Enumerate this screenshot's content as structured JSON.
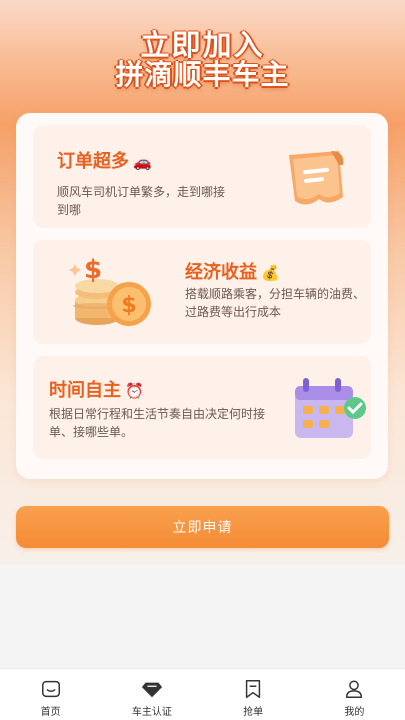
{
  "hero": {
    "title_line1": "立即加入",
    "title_line2": "拼滴顺丰车主"
  },
  "cards": [
    {
      "title": "订单超多",
      "emoji": "🚗",
      "desc": "顺风车司机订单繁多，走到哪接到哪",
      "icon": "receipt-icon"
    },
    {
      "title": "经济收益",
      "emoji": "💰",
      "desc": "搭载顺路乘客，分担车辆的油费、过路费等出行成本",
      "icon": "coins-icon"
    },
    {
      "title": "时间自主",
      "emoji": "⏰",
      "desc": "根据日常行程和生活节奏自由决定何时接单、接哪些单。",
      "icon": "calendar-check-icon"
    }
  ],
  "apply_button": {
    "label": "立即申请"
  },
  "tabbar": {
    "items": [
      {
        "label": "首页",
        "icon": "home-icon"
      },
      {
        "label": "车主认证",
        "icon": "diamond-icon"
      },
      {
        "label": "抢单",
        "icon": "bookmark-icon"
      },
      {
        "label": "我的",
        "icon": "person-icon"
      }
    ]
  },
  "colors": {
    "accent": "#e8611e",
    "button": "#f58b35",
    "card_bg": "#fdf1ea"
  }
}
